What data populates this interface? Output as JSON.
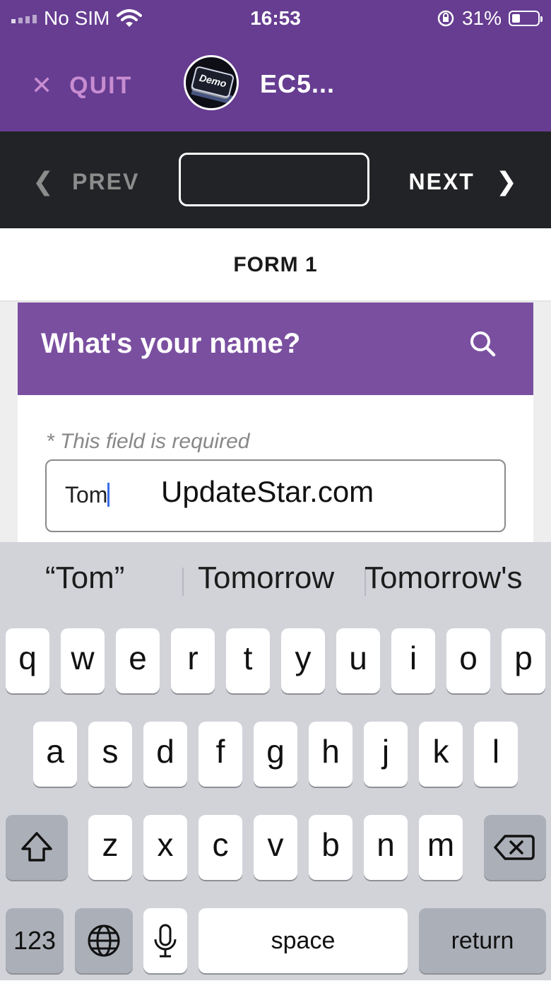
{
  "status_bar": {
    "carrier": "No SIM",
    "time": "16:53",
    "battery": "31%"
  },
  "app_header": {
    "quit_label": "QUIT",
    "avatar_text": "Demo",
    "title": "EC5..."
  },
  "nav": {
    "prev_label": "PREV",
    "next_label": "NEXT",
    "page_field_value": ""
  },
  "form": {
    "label": "FORM 1"
  },
  "card": {
    "question": "What's your name?",
    "required_note": "* This field is required",
    "input_value": "Tom"
  },
  "watermark": "UpdateStar.com",
  "keyboard": {
    "suggestions": [
      "“Tom”",
      "Tomorrow",
      "Tomorrow's"
    ],
    "row1": [
      "q",
      "w",
      "e",
      "r",
      "t",
      "y",
      "u",
      "i",
      "o",
      "p"
    ],
    "row2": [
      "a",
      "s",
      "d",
      "f",
      "g",
      "h",
      "j",
      "k",
      "l"
    ],
    "row3": [
      "z",
      "x",
      "c",
      "v",
      "b",
      "n",
      "m"
    ],
    "numbers_label": "123",
    "space_label": "space",
    "return_label": "return"
  },
  "colors": {
    "header": "#663d91",
    "card_header": "#7a4fa0",
    "nav_bg": "#222326",
    "quit": "#c88cd0",
    "keyboard_bg": "#d1d3d9"
  },
  "icons": [
    "wifi-icon",
    "orientation-lock-icon",
    "battery-icon",
    "close-icon",
    "chevron-left-icon",
    "chevron-right-icon",
    "search-icon",
    "shift-icon",
    "backspace-icon",
    "globe-icon",
    "microphone-icon"
  ]
}
